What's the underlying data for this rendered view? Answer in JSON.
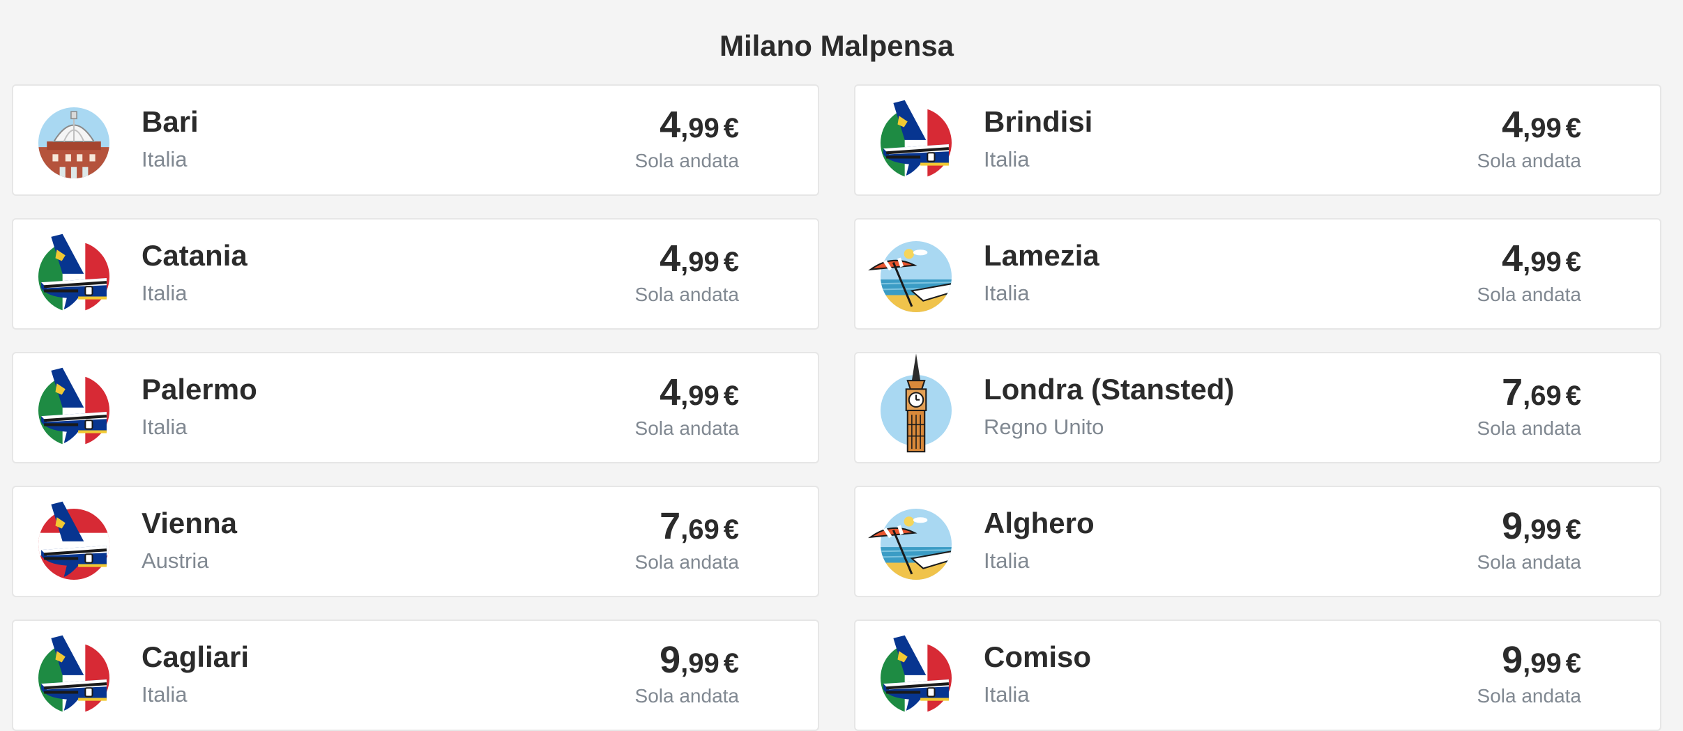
{
  "title": "Milano Malpensa",
  "destinations": [
    {
      "city": "Bari",
      "country": "Italia",
      "price_int": "4",
      "price_dec": ",99",
      "currency": "€",
      "trip": "Sola andata",
      "icon": "cathedral-icon"
    },
    {
      "city": "Brindisi",
      "country": "Italia",
      "price_int": "4",
      "price_dec": ",99",
      "currency": "€",
      "trip": "Sola andata",
      "icon": "plane-tail-italy-icon"
    },
    {
      "city": "Catania",
      "country": "Italia",
      "price_int": "4",
      "price_dec": ",99",
      "currency": "€",
      "trip": "Sola andata",
      "icon": "plane-tail-italy-icon"
    },
    {
      "city": "Lamezia",
      "country": "Italia",
      "price_int": "4",
      "price_dec": ",99",
      "currency": "€",
      "trip": "Sola andata",
      "icon": "beach-umbrella-icon"
    },
    {
      "city": "Palermo",
      "country": "Italia",
      "price_int": "4",
      "price_dec": ",99",
      "currency": "€",
      "trip": "Sola andata",
      "icon": "plane-tail-italy-icon"
    },
    {
      "city": "Londra (Stansted)",
      "country": "Regno Unito",
      "price_int": "7",
      "price_dec": ",69",
      "currency": "€",
      "trip": "Sola andata",
      "icon": "big-ben-icon"
    },
    {
      "city": "Vienna",
      "country": "Austria",
      "price_int": "7",
      "price_dec": ",69",
      "currency": "€",
      "trip": "Sola andata",
      "icon": "plane-tail-austria-icon"
    },
    {
      "city": "Alghero",
      "country": "Italia",
      "price_int": "9",
      "price_dec": ",99",
      "currency": "€",
      "trip": "Sola andata",
      "icon": "beach-umbrella-icon"
    },
    {
      "city": "Cagliari",
      "country": "Italia",
      "price_int": "9",
      "price_dec": ",99",
      "currency": "€",
      "trip": "Sola andata",
      "icon": "plane-tail-italy-icon"
    },
    {
      "city": "Comiso",
      "country": "Italia",
      "price_int": "9",
      "price_dec": ",99",
      "currency": "€",
      "trip": "Sola andata",
      "icon": "plane-tail-italy-icon"
    }
  ],
  "colors": {
    "text": "#2b2b2b",
    "muted": "#808891",
    "background": "#f4f4f4",
    "card": "#ffffff",
    "ryanair_blue": "#073590",
    "ryanair_yellow": "#f1c933"
  }
}
